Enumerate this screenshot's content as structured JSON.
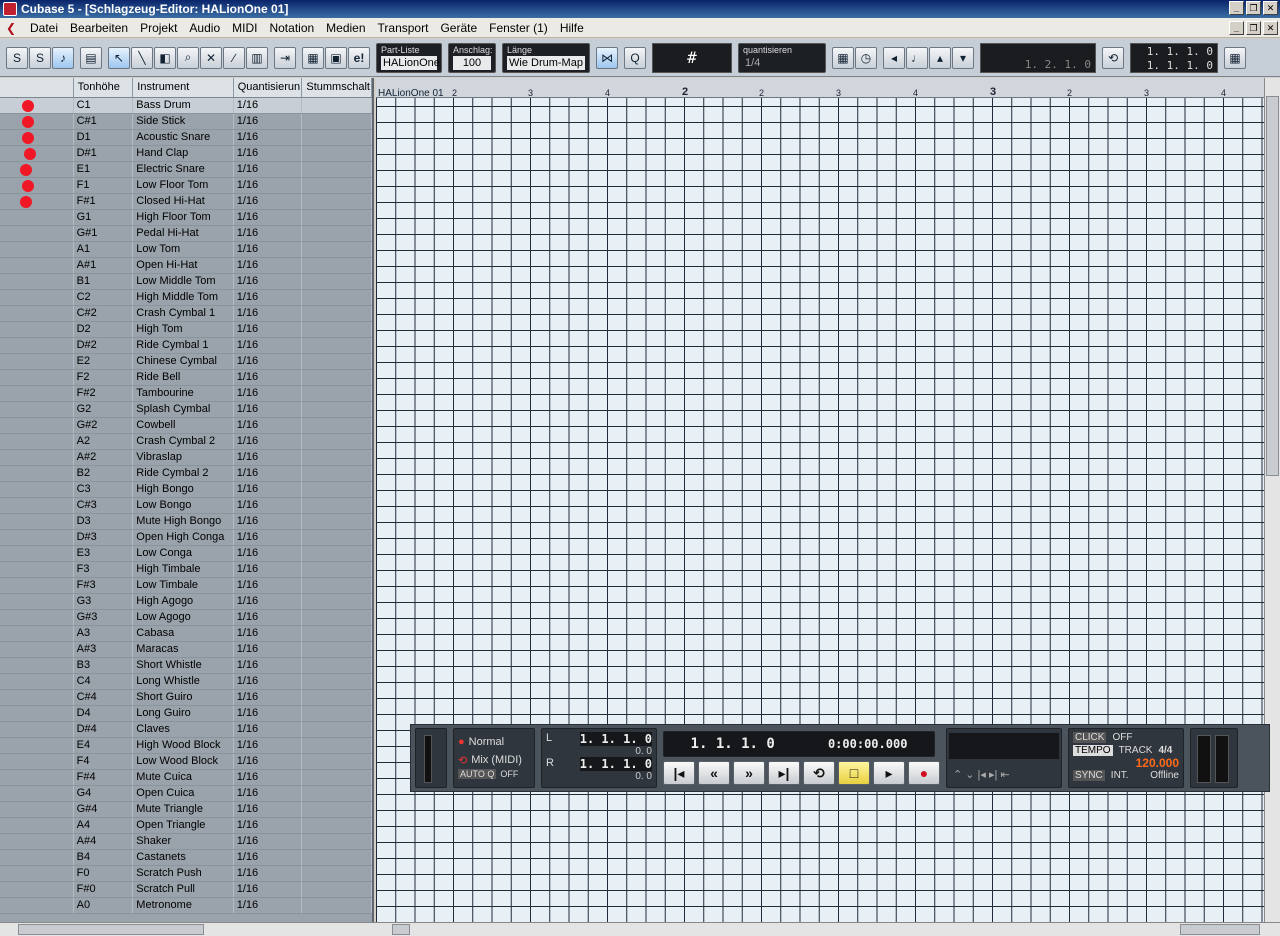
{
  "window": {
    "title": "Cubase 5 - [Schlagzeug-Editor: HALionOne 01]"
  },
  "menu": [
    "Datei",
    "Bearbeiten",
    "Projekt",
    "Audio",
    "MIDI",
    "Notation",
    "Medien",
    "Transport",
    "Geräte",
    "Fenster (1)",
    "Hilfe"
  ],
  "toolbar": {
    "part_list_label": "Part-Liste",
    "part_list_value": "HALionOne",
    "velocity_label": "Anschlag:",
    "velocity_value": "100",
    "length_label": "Länge",
    "length_value": "Wie Drum-Map",
    "grid_symbol": "#",
    "quantize_label": "quantisieren",
    "quantize_value": "1/4",
    "lcd1_bottom": "1. 2. 1.   0",
    "pos1": "1.  1.  1.    0",
    "pos2": "1.  1.  1.    0"
  },
  "columns": [
    "Tonhöhe",
    "Instrument",
    "Quantisierun",
    "Stummschalt"
  ],
  "instruments": [
    {
      "pitch": "C1",
      "name": "Bass Drum",
      "q": "1/16",
      "dot": true
    },
    {
      "pitch": "C#1",
      "name": "Side Stick",
      "q": "1/16",
      "dot": true
    },
    {
      "pitch": "D1",
      "name": "Acoustic Snare",
      "q": "1/16",
      "dot": true
    },
    {
      "pitch": "D#1",
      "name": "Hand Clap",
      "q": "1/16",
      "dot": true
    },
    {
      "pitch": "E1",
      "name": "Electric Snare",
      "q": "1/16",
      "dot": true
    },
    {
      "pitch": "F1",
      "name": "Low Floor Tom",
      "q": "1/16",
      "dot": true
    },
    {
      "pitch": "F#1",
      "name": "Closed Hi-Hat",
      "q": "1/16",
      "dot": true
    },
    {
      "pitch": "G1",
      "name": "High Floor Tom",
      "q": "1/16"
    },
    {
      "pitch": "G#1",
      "name": "Pedal Hi-Hat",
      "q": "1/16"
    },
    {
      "pitch": "A1",
      "name": "Low Tom",
      "q": "1/16"
    },
    {
      "pitch": "A#1",
      "name": "Open Hi-Hat",
      "q": "1/16"
    },
    {
      "pitch": "B1",
      "name": "Low Middle Tom",
      "q": "1/16"
    },
    {
      "pitch": "C2",
      "name": "High Middle Tom",
      "q": "1/16"
    },
    {
      "pitch": "C#2",
      "name": "Crash Cymbal 1",
      "q": "1/16"
    },
    {
      "pitch": "D2",
      "name": "High Tom",
      "q": "1/16"
    },
    {
      "pitch": "D#2",
      "name": "Ride Cymbal 1",
      "q": "1/16"
    },
    {
      "pitch": "E2",
      "name": "Chinese Cymbal",
      "q": "1/16"
    },
    {
      "pitch": "F2",
      "name": "Ride Bell",
      "q": "1/16"
    },
    {
      "pitch": "F#2",
      "name": "Tambourine",
      "q": "1/16"
    },
    {
      "pitch": "G2",
      "name": "Splash Cymbal",
      "q": "1/16"
    },
    {
      "pitch": "G#2",
      "name": "Cowbell",
      "q": "1/16"
    },
    {
      "pitch": "A2",
      "name": "Crash Cymbal 2",
      "q": "1/16"
    },
    {
      "pitch": "A#2",
      "name": "Vibraslap",
      "q": "1/16"
    },
    {
      "pitch": "B2",
      "name": "Ride Cymbal 2",
      "q": "1/16"
    },
    {
      "pitch": "C3",
      "name": "High Bongo",
      "q": "1/16"
    },
    {
      "pitch": "C#3",
      "name": "Low Bongo",
      "q": "1/16"
    },
    {
      "pitch": "D3",
      "name": "Mute High Bongo",
      "q": "1/16"
    },
    {
      "pitch": "D#3",
      "name": "Open High Conga",
      "q": "1/16"
    },
    {
      "pitch": "E3",
      "name": "Low Conga",
      "q": "1/16"
    },
    {
      "pitch": "F3",
      "name": "High Timbale",
      "q": "1/16"
    },
    {
      "pitch": "F#3",
      "name": "Low Timbale",
      "q": "1/16"
    },
    {
      "pitch": "G3",
      "name": "High Agogo",
      "q": "1/16"
    },
    {
      "pitch": "G#3",
      "name": "Low Agogo",
      "q": "1/16"
    },
    {
      "pitch": "A3",
      "name": "Cabasa",
      "q": "1/16"
    },
    {
      "pitch": "A#3",
      "name": "Maracas",
      "q": "1/16"
    },
    {
      "pitch": "B3",
      "name": "Short Whistle",
      "q": "1/16"
    },
    {
      "pitch": "C4",
      "name": "Long Whistle",
      "q": "1/16"
    },
    {
      "pitch": "C#4",
      "name": "Short Guiro",
      "q": "1/16"
    },
    {
      "pitch": "D4",
      "name": "Long Guiro",
      "q": "1/16"
    },
    {
      "pitch": "D#4",
      "name": "Claves",
      "q": "1/16"
    },
    {
      "pitch": "E4",
      "name": "High Wood Block",
      "q": "1/16"
    },
    {
      "pitch": "F4",
      "name": "Low Wood Block",
      "q": "1/16"
    },
    {
      "pitch": "F#4",
      "name": "Mute Cuica",
      "q": "1/16"
    },
    {
      "pitch": "G4",
      "name": "Open Cuica",
      "q": "1/16"
    },
    {
      "pitch": "G#4",
      "name": "Mute Triangle",
      "q": "1/16"
    },
    {
      "pitch": "A4",
      "name": "Open Triangle",
      "q": "1/16"
    },
    {
      "pitch": "A#4",
      "name": "Shaker",
      "q": "1/16"
    },
    {
      "pitch": "B4",
      "name": "Castanets",
      "q": "1/16"
    },
    {
      "pitch": "F0",
      "name": "Scratch Push",
      "q": "1/16"
    },
    {
      "pitch": "F#0",
      "name": "Scratch Pull",
      "q": "1/16"
    },
    {
      "pitch": "A0",
      "name": "Metronome",
      "q": "1/16"
    }
  ],
  "ruler": {
    "part_name": "HALionOne 01",
    "ticks": [
      "2",
      "3",
      "4",
      "2",
      "2",
      "3",
      "4",
      "3",
      "2",
      "3",
      "4"
    ]
  },
  "transport": {
    "mode": "Normal",
    "mix": "Mix (MIDI)",
    "autoq_label": "AUTO Q",
    "autoq_value": "OFF",
    "left_locator": "1.  1.  1.    0",
    "left_sub": "0.   0",
    "right_locator": "1.  1.  1.    0",
    "right_sub": "0.   0",
    "position": "1.  1.  1.    0",
    "time": "0:00:00.000",
    "click_label": "CLICK",
    "click_value": "OFF",
    "tempo_label": "TEMPO",
    "tempo_mode": "TRACK",
    "signature": "4/4",
    "tempo": "120.000",
    "sync_label": "SYNC",
    "sync_mode": "INT.",
    "sync_status": "Offline"
  },
  "colors": {
    "dot": "#f01826",
    "accent": "#e8d040",
    "tempo": "#ff6a1a"
  }
}
